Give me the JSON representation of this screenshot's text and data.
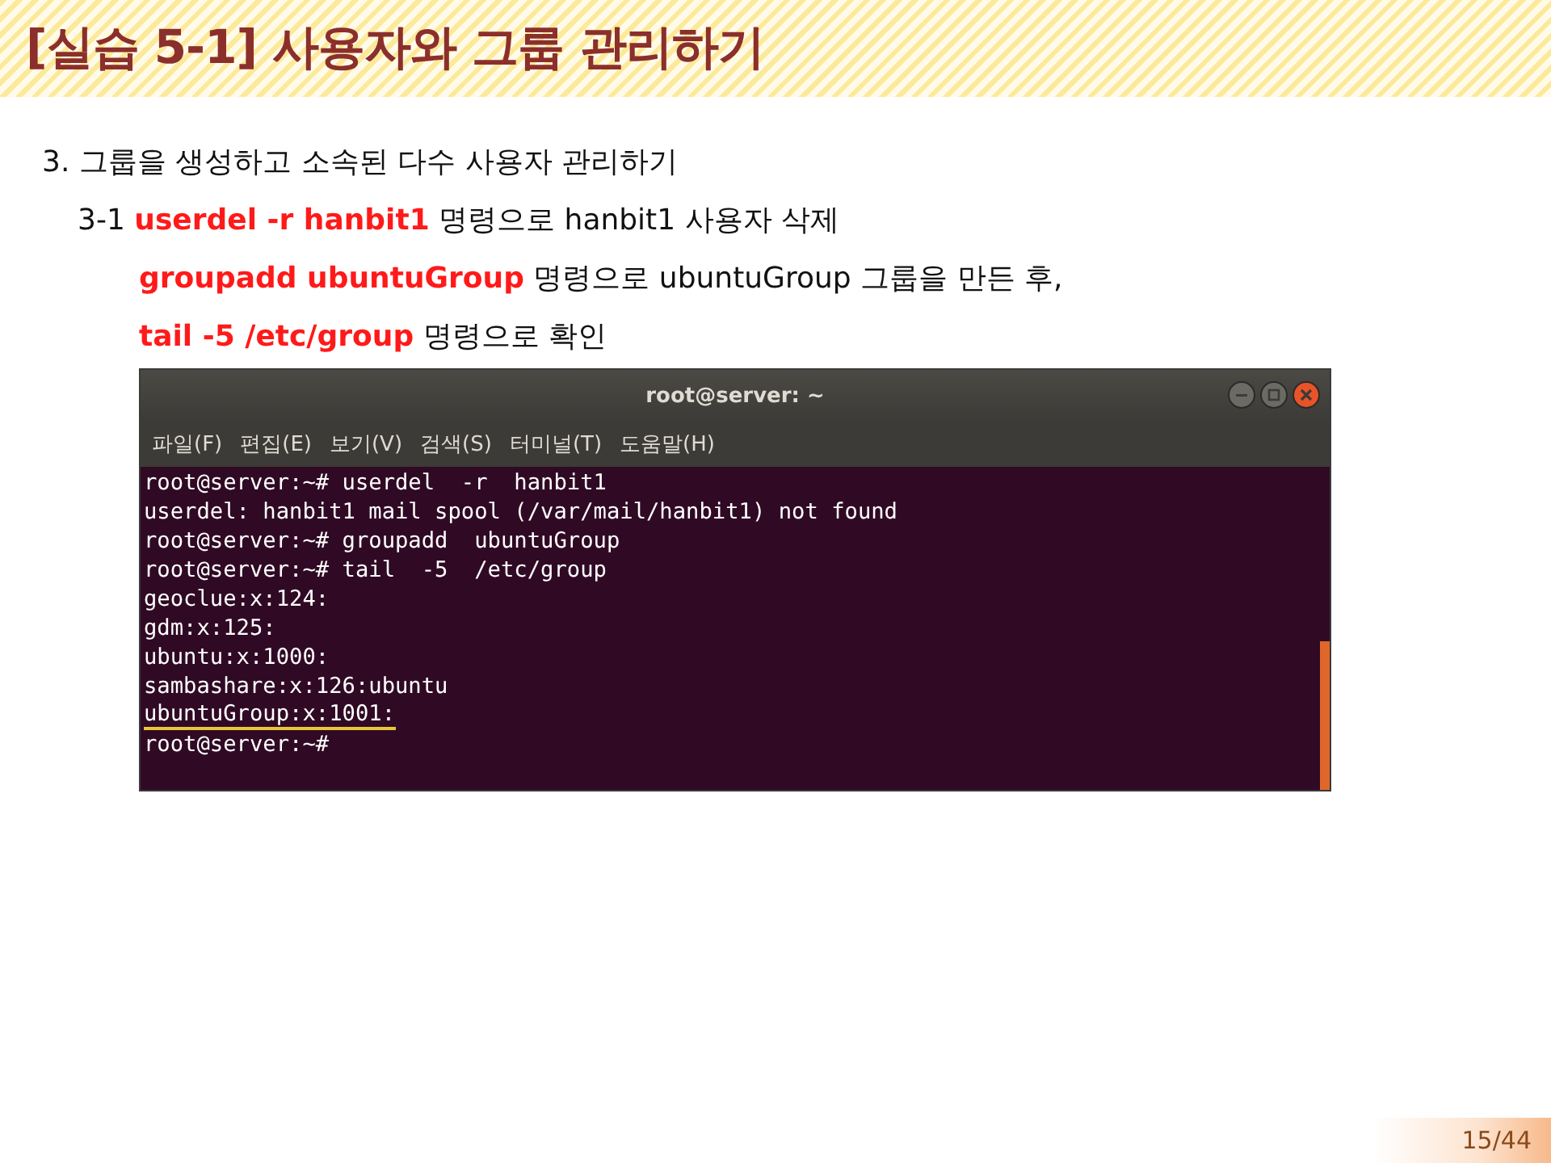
{
  "slide_title": "[실습 5-1] 사용자와 그룹 관리하기",
  "body": [
    {
      "text": "3. 그룹을 생성하고 소속된 다수 사용자 관리하기",
      "kind": "heading"
    },
    {
      "text": "3-1 **userdel  -r hanbit1**  명령으로 hanbit1 사용자 삭제",
      "kind": "step"
    },
    {
      "text": "**groupadd  ubuntuGroup** 명령으로 ubuntuGroup 그룹을 만든 후,",
      "kind": "continuation"
    },
    {
      "text": "**tail  -5 /etc/group** 명령으로 확인",
      "kind": "continuation"
    }
  ],
  "terminal": {
    "title": "root@server: ~",
    "menu": [
      "파일(F)",
      "편집(E)",
      "보기(V)",
      "검색(S)",
      "터미널(T)",
      "도움말(H)"
    ],
    "lines": [
      {
        "text": "root@server:~# userdel  -r  hanbit1",
        "highlighted": false
      },
      {
        "text": "userdel: hanbit1 mail spool (/var/mail/hanbit1) not found",
        "highlighted": false
      },
      {
        "text": "root@server:~# groupadd  ubuntuGroup",
        "highlighted": false
      },
      {
        "text": "root@server:~# tail  -5  /etc/group",
        "highlighted": false
      },
      {
        "text": "geoclue:x:124:",
        "highlighted": false
      },
      {
        "text": "gdm:x:125:",
        "highlighted": false
      },
      {
        "text": "ubuntu:x:1000:",
        "highlighted": false
      },
      {
        "text": "sambashare:x:126:ubuntu",
        "highlighted": false
      },
      {
        "text": "ubuntuGroup:x:1001:",
        "highlighted": true
      },
      {
        "text": "root@server:~#",
        "highlighted": false
      }
    ]
  },
  "page_number": "15/44"
}
